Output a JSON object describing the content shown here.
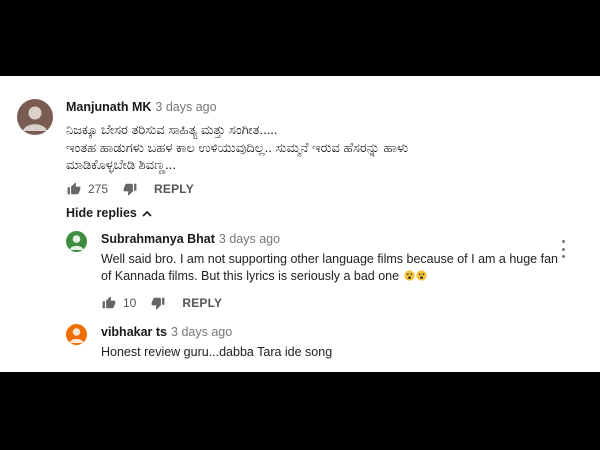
{
  "comments": [
    {
      "author": "Manjunath MK",
      "time": "3 days ago",
      "lines": [
        "ನಿಜಕ್ಕೂ ಬೇಸರ ತರಿಸುವ ಸಾಹಿತ್ಯ ಮತ್ತು ಸಂಗೀತ.....",
        "ಇಂತಹ ಹಾಡುಗಳು ಬಹಳ ಕಾಲ ಉಳಿಯುವುದಿಲ್ಲ.. ಸುಮ್ಮನೆ ಇರುವ ಹೆಸರನ್ನು ಹಾಳು",
        "ಮಾಡಿಕೊಳ್ಳಬೇಡಿ ಶಿವಣ್ಣ..."
      ],
      "likes": "275",
      "reply_label": "REPLY",
      "hide_replies_label": "Hide replies"
    }
  ],
  "replies": [
    {
      "author": "Subrahmanya Bhat",
      "time": "3 days ago",
      "lines": [
        "Well said bro. I am not supporting other language films because of I am a huge fan",
        "of Kannada films. But this lyrics is seriously a bad one"
      ],
      "emoji": "😧😧",
      "likes": "10",
      "reply_label": "REPLY",
      "avatar_color": "#3e8e41"
    },
    {
      "author": "vibhakar ts",
      "time": "3 days ago",
      "lines": [
        "Honest review guru...dabba Tara ide song"
      ],
      "avatar_color": "#ef6c00"
    }
  ],
  "colors": {
    "main_avatar": "#7b5c52",
    "background": "#ffffff",
    "frame": "#000000"
  }
}
